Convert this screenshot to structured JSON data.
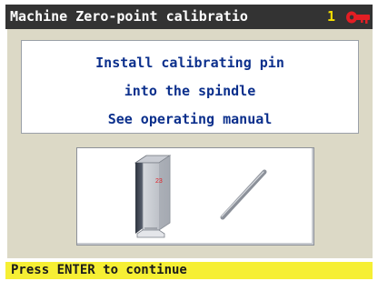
{
  "window": {
    "title": "Machine Zero-point calibratio",
    "number": "1",
    "logo_icon": "key-logo-icon"
  },
  "message": {
    "lines": [
      "Install calibrating pin",
      "into the spindle",
      "See operating manual"
    ]
  },
  "illustration": {
    "block_label": "23",
    "icons": [
      "clamp-block-icon",
      "calibrating-pin-icon"
    ]
  },
  "status": {
    "text": "Press ENTER to continue"
  },
  "colors": {
    "titlebar_bg": "#333333",
    "number_text": "#f5e000",
    "logo": "#e31e24",
    "panel_bg": "#dcd9c6",
    "message_text": "#0b2f8c",
    "status_bg": "#f6ef34"
  }
}
